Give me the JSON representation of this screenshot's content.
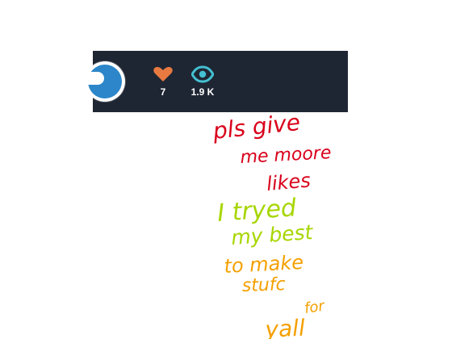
{
  "stats": {
    "likes": "7",
    "views": "1.9 K"
  },
  "icons": {
    "likes": "heart-icon",
    "views": "eye-icon",
    "remix": "remix-button-icon"
  },
  "colors": {
    "bar_background": "#1f2633",
    "heart": "#e87a41",
    "eye": "#43c0d1",
    "remix": "#2c86c9",
    "note_red": "#d9001b",
    "note_green": "#a7d600",
    "note_orange": "#f4a000"
  },
  "note": {
    "line1": "pls  give",
    "line2": "me  moore",
    "line3": "likes",
    "line4": "I tryed",
    "line5": "my best",
    "line6": "to make",
    "line7": "stufc",
    "line8": "for",
    "line9": "yall"
  }
}
